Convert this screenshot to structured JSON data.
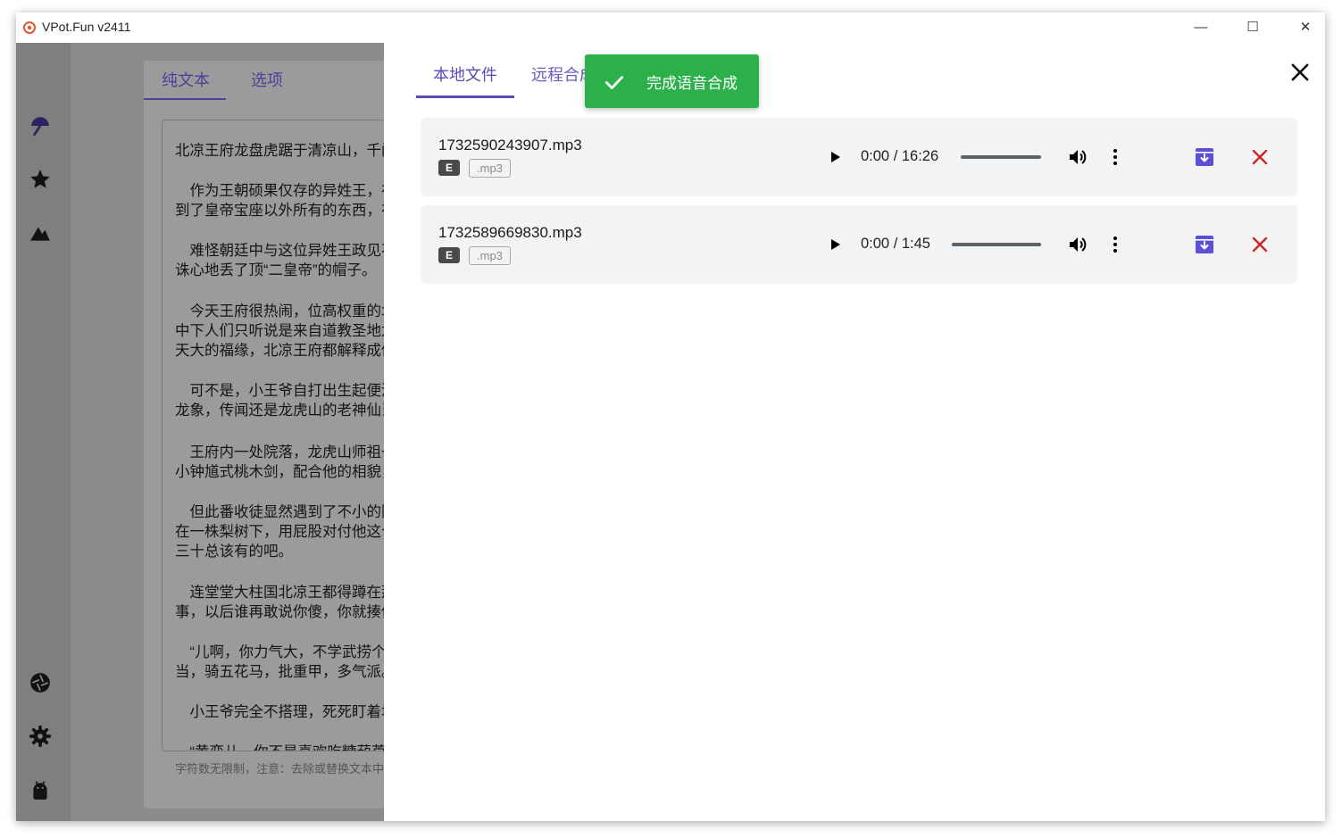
{
  "window": {
    "title": "VPot.Fun v2411",
    "controls": {
      "minimize": "—",
      "maximize": "☐",
      "close": "✕"
    }
  },
  "sidebar": {
    "icons": [
      "umbrella-icon",
      "star-icon",
      "triangle-logo-icon",
      "aperture-icon",
      "gear-icon",
      "android-icon"
    ]
  },
  "background": {
    "tabs": [
      "纯文本",
      "选项"
    ],
    "paragraphs": [
      "北凉王府龙盘虎踞于清凉山，千门万户",
      "　作为王朝硕果仅存的异姓王，在庙堂\n到了皇帝宝座以外所有的东西，在西北",
      "　难怪朝廷中与这位异姓王政见不合的\n诛心地丢了顶“二皇帝”的帽子。",
      "　今天王府很热闹，位高权重的北凉王\n中下人们只听说是来自道教圣地龙虎山\n天大的福缘，北凉王府都解释成傻人有",
      "　可不是，小王爷自打出生起便没哭过\n龙象，传闻还是龙虎山的老神仙当年给",
      "　王府内一处院落，龙虎山师祖一级的\n小钟馗式桃木剑，配合他的相貌，确实",
      "　但此番收徒显然遇到了不小的阻碍，\n在一株梨树下，用屁股对付他这个天下\n三十总该有的吧。",
      "　连堂堂大柱国北凉王都得蹲在那里好\n事，以后谁再敢说你傻，你就揍他，三",
      "　“儿啊，你力气大，不学武捞个天下\n当，骑五花马，批重甲，多气派。”",
      "　小王爷完全不搭理，死死盯着地面，",
      "　“黄蛮儿，你不是喜欢吃糖葫芦吗，那"
    ],
    "helper_text": "字符数无限制，注意：去除或替换文本中含有"
  },
  "panel": {
    "tabs": [
      "本地文件",
      "远程合成"
    ],
    "active_tab": 0,
    "toast": "完成语音合成",
    "files": [
      {
        "name": "1732590243907.mp3",
        "badge": "E",
        "ext": ".mp3",
        "time": "0:00 / 16:26"
      },
      {
        "name": "1732589669830.mp3",
        "badge": "E",
        "ext": ".mp3",
        "time": "0:00 / 1:45"
      }
    ]
  },
  "colors": {
    "accent": "#5a4bb5",
    "toast_bg": "#2bb04a",
    "download": "#5b4fd8",
    "remove": "#c62828",
    "overlay": "#8b8b8b"
  }
}
